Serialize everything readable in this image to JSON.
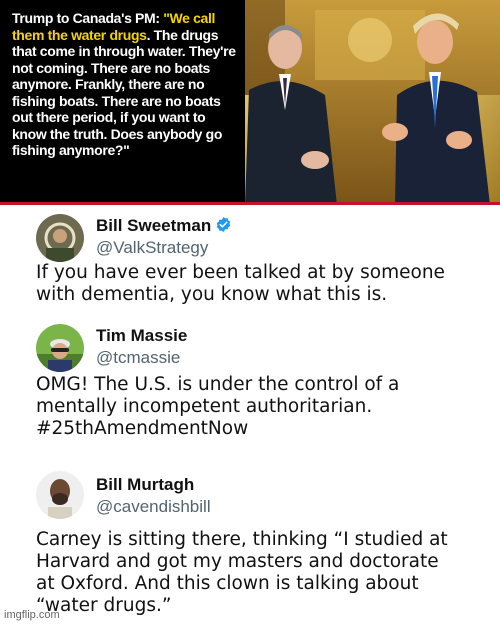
{
  "banner": {
    "quote_lead": "Trump to Canada's PM: ",
    "quote_open": "\"We call them the ",
    "quote_highlight": "water drugs",
    "quote_rest": ". The drugs that come in through water. They're not coming. There are no boats anymore. Frankly, there are no fishing boats. There are no boats out there period, if you want to know the truth. Does anybody go fishing anymore?\"",
    "colors": {
      "background": "#000000",
      "accent_yellow": "#f5d400",
      "rule_red": "#c8102e"
    }
  },
  "posts": [
    {
      "name": "Bill Sweetman",
      "verified": true,
      "verified_icon": "verified-badge-icon",
      "handle": "@ValkStrategy",
      "text": "If you have ever been talked at by someone\nwith dementia, you know what this is."
    },
    {
      "name": "Tim Massie",
      "verified": false,
      "handle": "@tcmassie",
      "text": "OMG! The U.S. is under the control of a\nmentally incompetent authoritarian.\n#25thAmendmentNow"
    },
    {
      "name": "Bill Murtagh",
      "verified": false,
      "handle": "@cavendishbill",
      "text": "Carney is sitting there, thinking “I studied at\nHarvard and got my masters and doctorate\nat Oxford. And this clown is talking about\n“water drugs.”"
    }
  ],
  "watermark": "imgflip.com"
}
